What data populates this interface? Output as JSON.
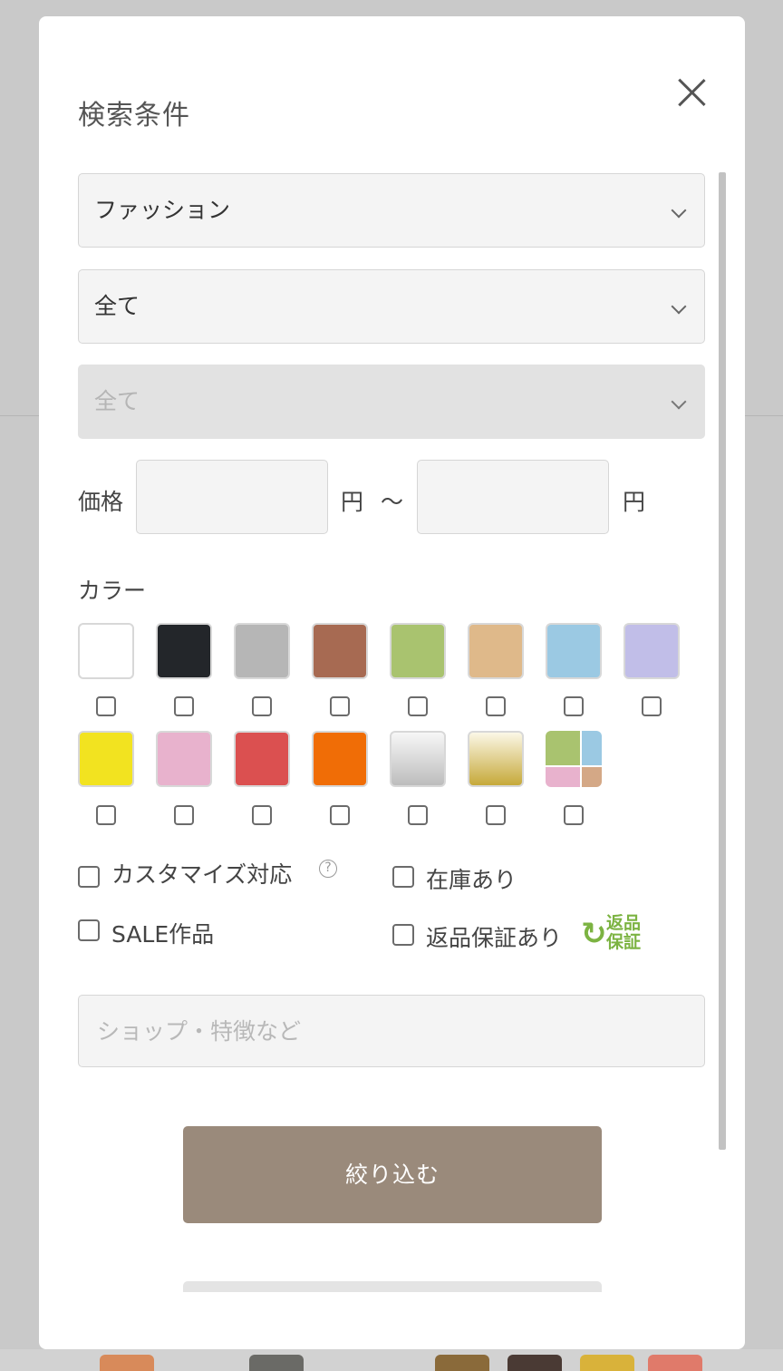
{
  "modal": {
    "title": "検索条件"
  },
  "filters": {
    "category": "ファッション",
    "subcategory": "全て",
    "subsubcategory": "全て"
  },
  "price": {
    "label": "価格",
    "unit_min": "円",
    "separator": "～",
    "unit_max": "円",
    "min_value": "",
    "max_value": ""
  },
  "colors": {
    "label": "カラー",
    "swatches": [
      "#ffffff",
      "#23262a",
      "#b6b6b6",
      "#a76a52",
      "#a9c36f",
      "#dfb98a",
      "#9bc9e3",
      "#c1bee8",
      "#f2e320",
      "#e8b2cd",
      "#db5050",
      "#f06d06",
      "silver-gradient",
      "gold-gradient",
      "multi-color"
    ]
  },
  "options": {
    "customize": "カスタマイズ対応",
    "help": "?",
    "in_stock": "在庫あり",
    "sale": "SALE作品",
    "return_guarantee": "返品保証あり",
    "return_badge_line1": "返品",
    "return_badge_line2": "保証"
  },
  "keyword": {
    "placeholder": "ショップ・特徴など",
    "value": ""
  },
  "actions": {
    "submit": "絞り込む"
  }
}
